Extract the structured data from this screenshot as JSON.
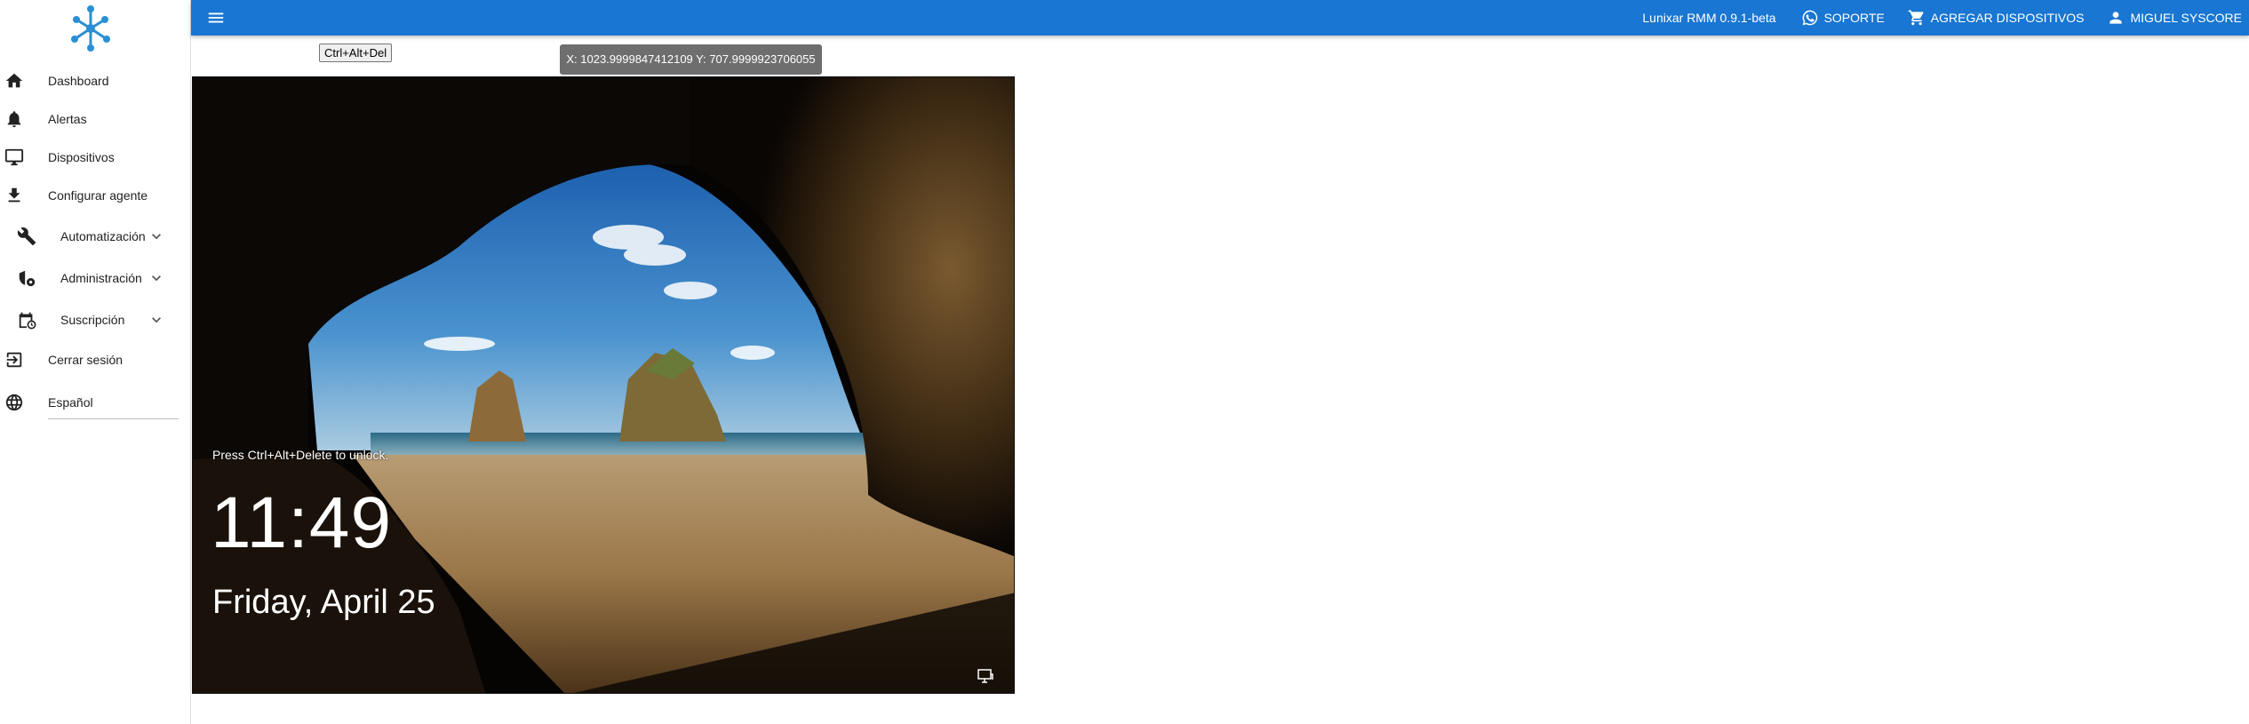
{
  "app": {
    "version": "Lunixar RMM 0.9.1-beta",
    "brand_color": "#1976d2"
  },
  "topbar": {
    "menu_icon": "hamburger-menu-icon",
    "support_label": "SOPORTE",
    "add_devices_label": "AGREGAR DISPOSITIVOS",
    "user_label": "MIGUEL SYSCORE"
  },
  "sidebar": {
    "items": [
      {
        "label": "Dashboard",
        "icon": "home-icon"
      },
      {
        "label": "Alertas",
        "icon": "bell-icon"
      },
      {
        "label": "Dispositivos",
        "icon": "monitor-icon"
      },
      {
        "label": "Configurar agente",
        "icon": "download-icon"
      },
      {
        "label": "Automatización",
        "icon": "wrench-icon"
      },
      {
        "label": "Administración",
        "icon": "admin-icon"
      },
      {
        "label": "Suscripción",
        "icon": "calendar-clock-icon"
      },
      {
        "label": "Cerrar sesión",
        "icon": "logout-icon"
      },
      {
        "label": "Español",
        "icon": "globe-icon"
      }
    ]
  },
  "remote": {
    "cad_button_label": "Ctrl+Alt+Del",
    "coords": "X: 1023.9999847412109   Y: 707.9999923706055",
    "lockscreen": {
      "unlock_text": "Press Ctrl+Alt+Delete to unlock.",
      "time": "11:49",
      "date": "Friday, April 25"
    }
  }
}
